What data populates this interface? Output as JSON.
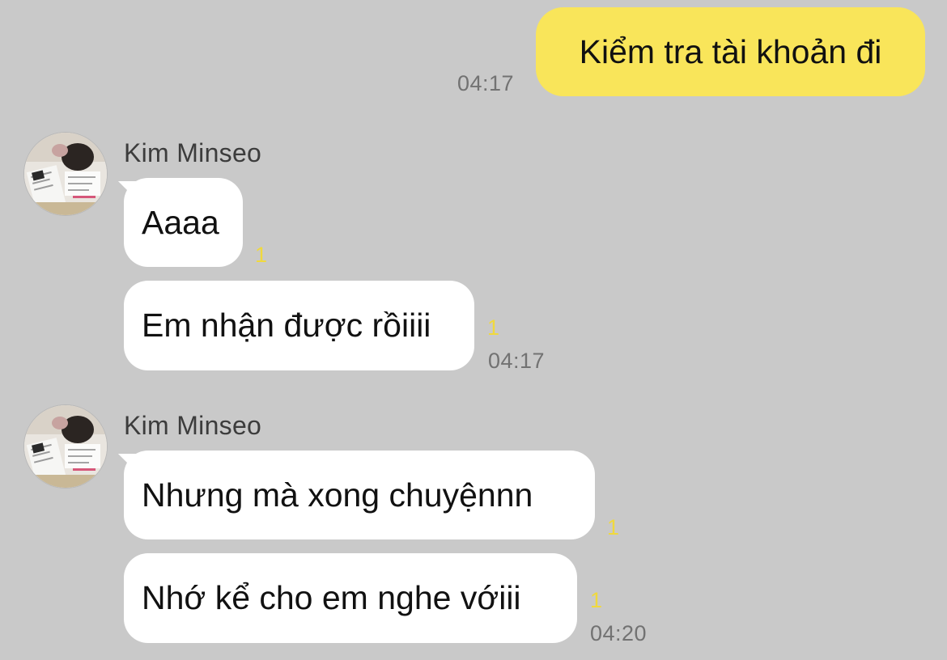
{
  "colors": {
    "background": "#c9c9c9",
    "my_bubble": "#f9e55a",
    "their_bubble": "#ffffff",
    "unread": "#f0d93d",
    "time_text": "#727272"
  },
  "messages": {
    "outgoing_1": {
      "text": "Kiểm tra tài khoản đi",
      "time": "04:17"
    },
    "group_1": {
      "sender": "Kim Minseo",
      "avatar_icon": "profile-photo-avatar",
      "msg_1": {
        "text": "Aaaa",
        "unread": "1"
      },
      "msg_2": {
        "text": "Em nhận được rồiiii",
        "unread": "1",
        "time": "04:17"
      }
    },
    "group_2": {
      "sender": "Kim Minseo",
      "avatar_icon": "profile-photo-avatar",
      "msg_1": {
        "text": "Nhưng mà xong chuyệnnn",
        "unread": "1"
      },
      "msg_2": {
        "text": "Nhớ kể cho em nghe vớiii",
        "unread": "1",
        "time": "04:20"
      }
    }
  }
}
